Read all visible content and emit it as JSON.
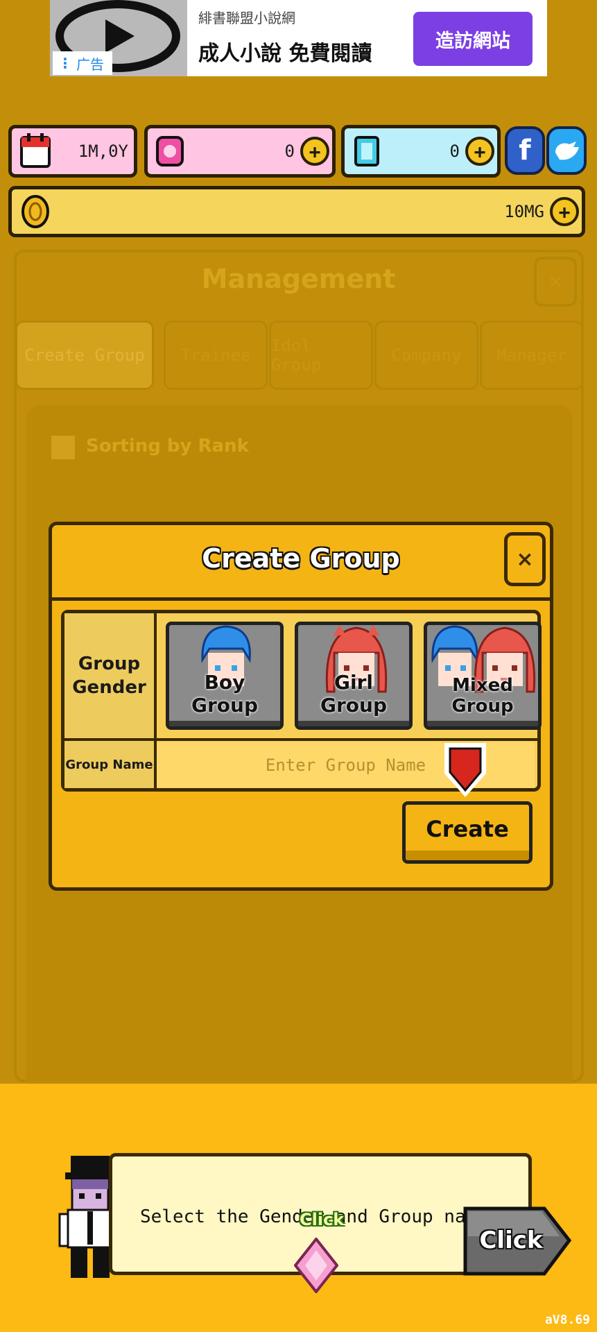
{
  "ad": {
    "label": "广告",
    "title": "緋書聯盟小說網",
    "subtitle": "成人小說 免費閱讀",
    "button": "造訪網站"
  },
  "stats": {
    "date": "1M,0Y",
    "pink_gems": "0",
    "blue_gems": "0",
    "gold": "10MG"
  },
  "social": {
    "facebook": "f"
  },
  "background": {
    "panel_title": "Management",
    "tabs": [
      "Create Group",
      "Trainee",
      "Idol Group",
      "Company",
      "Manager"
    ],
    "sort_label": "Sorting by Rank"
  },
  "dialog": {
    "title": "Create Group",
    "gender_label_1": "Group",
    "gender_label_2": "Gender",
    "genders": [
      "Boy Group",
      "Girl Group",
      "Mixed Group"
    ],
    "name_label": "Group Name",
    "name_placeholder": "Enter Group Name",
    "create_button": "Create"
  },
  "tutorial": {
    "message": "Select the Gender and Group name.",
    "button": "Click",
    "hint": "Click"
  },
  "footer": {
    "version": "aV8.69"
  },
  "colors": {
    "accent": "#f4b414",
    "dim_background": "#c38f0a",
    "ad_button": "#7b3fe4",
    "pink_bar": "#ffc5e2",
    "blue_bar": "#bdeffb",
    "facebook": "#2f61c8",
    "twitter": "#2aa9f2"
  }
}
